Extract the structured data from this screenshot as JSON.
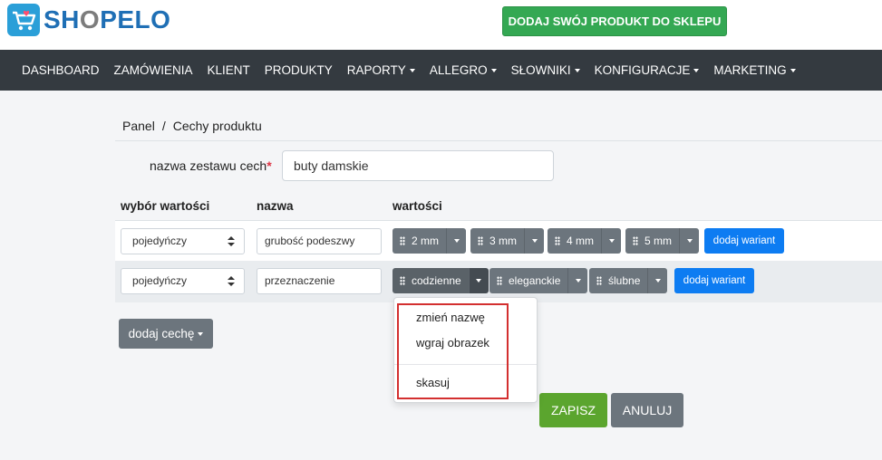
{
  "brand": {
    "logo_text_a": "SH",
    "logo_text_o": "O",
    "logo_text_b": "PELO",
    "cta_label": "DODAJ SWÓJ PRODUKT DO SKLEPU"
  },
  "nav": {
    "items": [
      {
        "label": "DASHBOARD",
        "has_caret": false
      },
      {
        "label": "ZAMÓWIENIA",
        "has_caret": false
      },
      {
        "label": "KLIENT",
        "has_caret": false
      },
      {
        "label": "PRODUKTY",
        "has_caret": false
      },
      {
        "label": "RAPORTY",
        "has_caret": true
      },
      {
        "label": "ALLEGRO",
        "has_caret": true
      },
      {
        "label": "SŁOWNIKI",
        "has_caret": true
      },
      {
        "label": "KONFIGURACJE",
        "has_caret": true
      },
      {
        "label": "MARKETING",
        "has_caret": true
      }
    ]
  },
  "breadcrumb": {
    "root": "Panel",
    "separator": "/",
    "current": "Cechy produktu"
  },
  "form": {
    "set_name_label": "nazwa zestawu cech",
    "required_mark": "*",
    "set_name_value": "buty damskie"
  },
  "table": {
    "headers": [
      "wybór wartości",
      "nazwa",
      "wartości"
    ],
    "rows": [
      {
        "selection": "pojedyńczy",
        "name": "grubość podeszwy",
        "values": [
          "2 mm",
          "3 mm",
          "4 mm",
          "5 mm"
        ],
        "add_variant": "dodaj wariant"
      },
      {
        "selection": "pojedyńczy",
        "name": "przeznaczenie",
        "values": [
          "codzienne",
          "eleganckie",
          "ślubne"
        ],
        "add_variant": "dodaj wariant"
      }
    ]
  },
  "dropdown_menu": {
    "items": [
      "zmień nazwę",
      "wgraj obrazek",
      "skasuj"
    ]
  },
  "actions": {
    "add_feature": "dodaj cechę",
    "save": "ZAPISZ",
    "cancel": "ANULUJ"
  },
  "colors": {
    "navbar": "#343a40",
    "cta_green": "#34a853",
    "save_green": "#5ba52e",
    "primary_blue": "#0d7cf2",
    "secondary_gray": "#6c757d",
    "highlight_red": "#d32f2f"
  }
}
